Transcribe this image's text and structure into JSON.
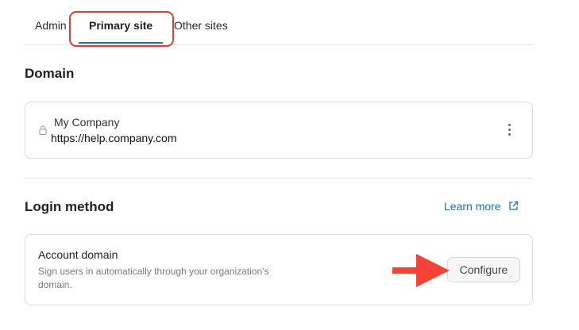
{
  "tabs": [
    {
      "label": "Admin"
    },
    {
      "label": "Primary site",
      "active": true
    },
    {
      "label": "Other sites"
    }
  ],
  "domain": {
    "title": "Domain",
    "site_name": "My Company",
    "site_url": "https://help.company.com"
  },
  "login": {
    "title": "Login method",
    "learn_more": "Learn more",
    "account_domain_title": "Account domain",
    "account_domain_desc": "Sign users in automatically through your organization's domain.",
    "configure_label": "Configure"
  },
  "colors": {
    "accent": "#1f6fc5",
    "highlight": "#e53935",
    "arrow": "#f44336"
  },
  "icons": [
    "lock-icon",
    "kebab-menu-icon",
    "external-link-icon",
    "arrow-right-icon"
  ]
}
